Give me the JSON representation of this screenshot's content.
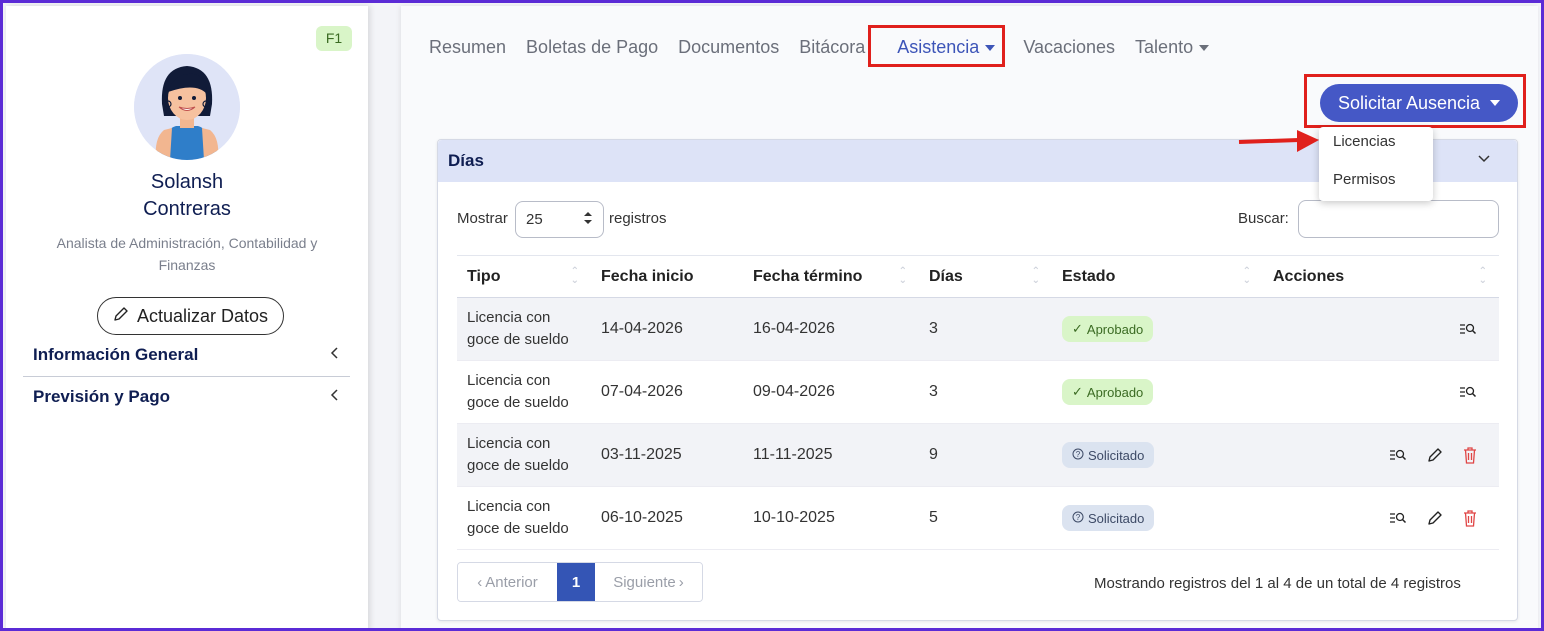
{
  "profile": {
    "badge": "F1",
    "first_name": "Solansh",
    "last_name": "Contreras",
    "role": "Analista de Administración, Contabilidad y Finanzas",
    "update_button": "Actualizar Datos",
    "sections": [
      {
        "label": "Información General"
      },
      {
        "label": "Previsión y Pago"
      }
    ]
  },
  "nav": {
    "tabs": [
      {
        "label": "Resumen"
      },
      {
        "label": "Boletas de Pago"
      },
      {
        "label": "Documentos"
      },
      {
        "label": "Bitácora"
      },
      {
        "label": "Asistencia",
        "active": true,
        "has_caret": true
      },
      {
        "label": "Vacaciones"
      },
      {
        "label": "Talento",
        "has_caret": true
      }
    ]
  },
  "request_button": {
    "label": "Solicitar Ausencia",
    "options": [
      {
        "label": "Licencias"
      },
      {
        "label": "Permisos"
      }
    ]
  },
  "card": {
    "title": "Días",
    "show_label": "Mostrar",
    "page_length": "25",
    "records_label": "registros",
    "search_label": "Buscar:",
    "search_value": "",
    "columns": [
      "Tipo",
      "Fecha inicio",
      "Fecha término",
      "Días",
      "Estado",
      "Acciones"
    ],
    "rows": [
      {
        "tipo_line1": "Licencia con",
        "tipo_line2": "goce de sueldo",
        "inicio": "14-04-2026",
        "termino": "16-04-2026",
        "dias": "3",
        "estado": "Aprobado",
        "status": "approved"
      },
      {
        "tipo_line1": "Licencia con",
        "tipo_line2": "goce de sueldo",
        "inicio": "07-04-2026",
        "termino": "09-04-2026",
        "dias": "3",
        "estado": "Aprobado",
        "status": "approved"
      },
      {
        "tipo_line1": "Licencia con",
        "tipo_line2": "goce de sueldo",
        "inicio": "03-11-2025",
        "termino": "11-11-2025",
        "dias": "9",
        "estado": "Solicitado",
        "status": "requested"
      },
      {
        "tipo_line1": "Licencia con",
        "tipo_line2": "goce de sueldo",
        "inicio": "06-10-2025",
        "termino": "10-10-2025",
        "dias": "5",
        "estado": "Solicitado",
        "status": "requested"
      }
    ],
    "pagination": {
      "prev": "Anterior",
      "current": "1",
      "next": "Siguiente"
    },
    "info": "Mostrando registros del 1 al 4 de un total de 4 registros"
  },
  "colors": {
    "primary": "#4558c6",
    "highlight": "#e0201c",
    "approved_bg": "#d9f5c8",
    "requested_bg": "#dbe3f0",
    "delete": "#e04545"
  },
  "icons": {
    "edit": "pencil-icon",
    "view": "view-details-icon",
    "delete": "trash-icon",
    "collapse": "chevron-left-icon",
    "card_toggle": "chevron-down-icon"
  }
}
